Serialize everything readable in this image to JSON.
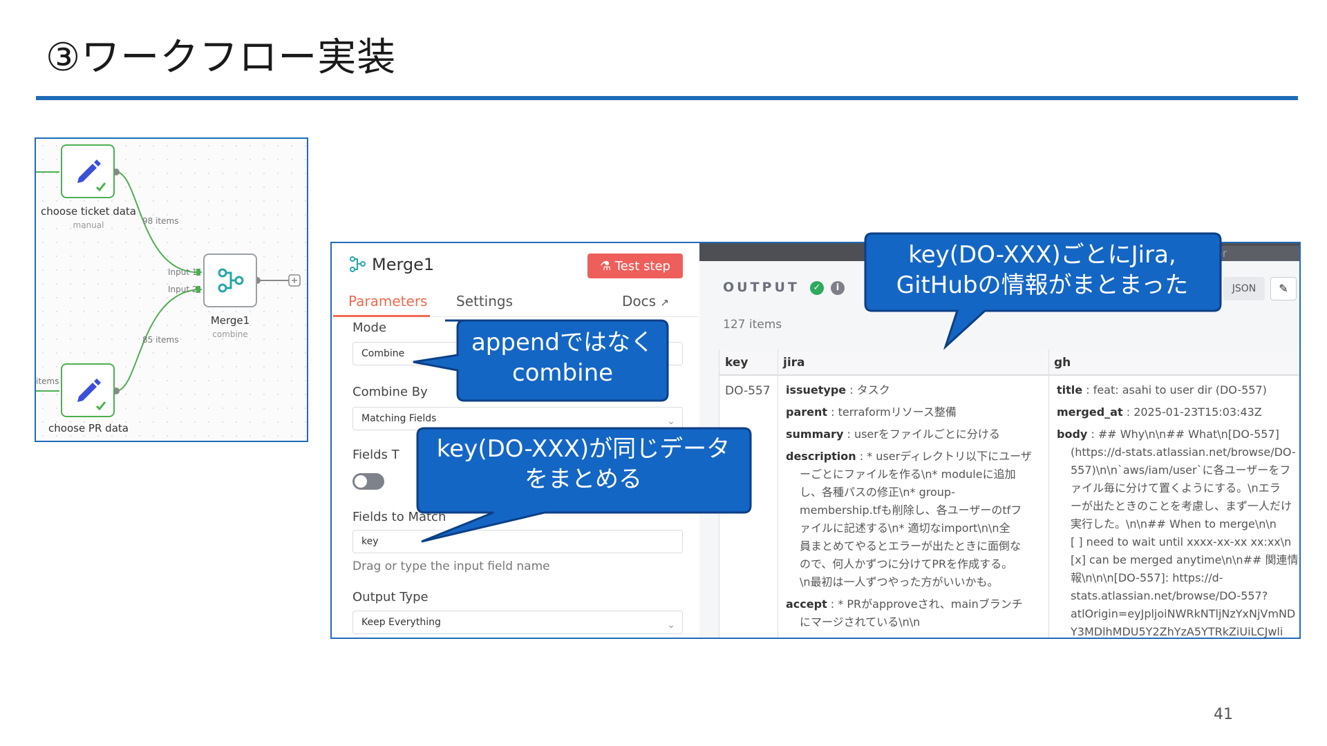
{
  "slide": {
    "title": "③ワークフロー実装",
    "page_number": "41"
  },
  "workflow": {
    "node_ticket": {
      "label": "choose ticket data",
      "sub": "manual"
    },
    "node_pr": {
      "label": "choose PR data"
    },
    "node_merge": {
      "label": "Merge1",
      "sub": "combine",
      "input1": "Input 1",
      "input2": "Input 2"
    },
    "edge_top_count": "98 items",
    "edge_bottom_count": "85 items",
    "left_edge_text": "items"
  },
  "panel": {
    "node_title": "Merge1",
    "test_button": "Test step",
    "tabs": {
      "parameters": "Parameters",
      "settings": "Settings",
      "docs": "Docs"
    },
    "mode": {
      "label": "Mode",
      "value": "Combine"
    },
    "combine_by": {
      "label": "Combine By",
      "value": "Matching Fields"
    },
    "fields_toggle_label": "Fields T",
    "fields_to_match": {
      "label": "Fields to Match",
      "value": "key",
      "hint": "Drag or type the input field name"
    },
    "output_type": {
      "label": "Output Type",
      "value": "Keep Everything"
    }
  },
  "output": {
    "editor_tab": "Editor",
    "title": "OUTPUT",
    "items_count": "127 items",
    "json_tab": "JSON",
    "columns": [
      "key",
      "jira",
      "gh"
    ],
    "row": {
      "key": "DO-557",
      "jira": [
        {
          "k": "issuetype",
          "v": "タスク"
        },
        {
          "k": "parent",
          "v": "terraformリソース整備"
        },
        {
          "k": "summary",
          "v": "userをファイルごとに分ける"
        },
        {
          "k": "description",
          "v": "* userディレクトリ以下にユーザ",
          "more": [
            "ーごとにファイルを作る\\n* moduleに追加",
            "し、各種パスの修正\\n* group-",
            "membership.tfも削除し、各ユーザーのtfフ",
            "ァイルに記述する\\n* 適切なimport\\n\\n全",
            "員まとめてやるとエラーが出たときに面倒な",
            "ので、何人かずつに分けてPRを作成する。",
            "\\n最初は一人ずつやった方がいいかも。"
          ]
        },
        {
          "k": "accept",
          "v": "* PRがapproveされ、mainブランチ",
          "more": [
            "にマージされている\\n\\n"
          ]
        }
      ],
      "gh": [
        {
          "k": "title",
          "v": "feat: asahi to user dir (DO-557)"
        },
        {
          "k": "merged_at",
          "v": "2025-01-23T15:03:43Z"
        },
        {
          "k": "body",
          "v": "## Why\\n\\n## What\\n[DO-557]",
          "more": [
            "(https://d-stats.atlassian.net/browse/DO-",
            "557)\\n\\n`aws/iam/user`に各ユーザーをフ",
            "ァイル毎に分けて置くようにする。\\nエラ",
            "ーが出たときのことを考慮し、まず一人だけ",
            "実行した。\\n\\n## When to merge\\n\\n",
            "[ ] need to wait until xxxx-xx-xx xx:xx\\n",
            "[x] can be merged anytime\\n\\n## 関連情",
            "報\\n\\n\\n[DO-557]: https://d-",
            "stats.atlassian.net/browse/DO-557?",
            "atlOrigin=eyJpljoiNWRkNTljNzYxNjVmND",
            "Y3MDlhMDU5Y2ZhYzA5YTRkZiUiLCJwli"
          ]
        }
      ]
    }
  },
  "callouts": {
    "top_right": [
      "key(DO-XXX)ごとにJira,",
      "GitHubの情報がまとまった"
    ],
    "append": [
      "appendではなく",
      "combine"
    ],
    "key_same": [
      "key(DO-XXX)が同じデータ",
      "をまとめる"
    ]
  },
  "colors": {
    "accent_blue": "#1f6bb8",
    "callout_blue": "#1466c4",
    "n8n_orange": "#ee6a4f",
    "success_green": "#4caf50"
  }
}
